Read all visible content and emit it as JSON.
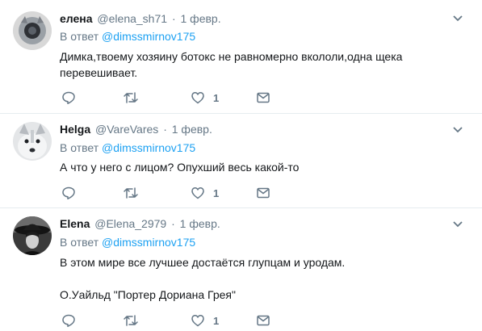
{
  "replying_prefix": "В ответ",
  "tweets": [
    {
      "name": "елена",
      "handle": "@elena_sh71",
      "separator": "·",
      "date": "1 февр.",
      "reply_to": "@dimssmirnov175",
      "text_lines": [
        "Димка,твоему хозяину ботокс не равномерно вкололи,одна щека",
        "перевешивает."
      ],
      "likes": "1",
      "avatar": "cat-avatar"
    },
    {
      "name": "Helga",
      "handle": "@VareVares",
      "separator": "·",
      "date": "1 февр.",
      "reply_to": "@dimssmirnov175",
      "text_lines": [
        "А что у него с лицом? Опухший весь какой-то"
      ],
      "likes": "1",
      "avatar": "husky-avatar"
    },
    {
      "name": "Elena",
      "handle": "@Elena_2979",
      "separator": "·",
      "date": "1 февр.",
      "reply_to": "@dimssmirnov175",
      "text_lines": [
        "В этом мире все лучшее достаётся глупцам и уродам.",
        "",
        "О.Уайльд \"Портер Дориана Грея\""
      ],
      "likes": "1",
      "avatar": "woman-hat-avatar"
    }
  ],
  "icons": {
    "reply": "reply-icon",
    "retweet": "retweet-icon",
    "like": "heart-icon",
    "message": "envelope-icon",
    "menu": "chevron-down-icon"
  },
  "colors": {
    "link": "#1da1f2",
    "muted": "#657786",
    "text": "#14171a",
    "border": "#e6ecf0"
  }
}
